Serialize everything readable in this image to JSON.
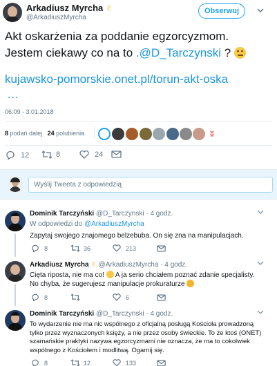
{
  "main_tweet": {
    "author_name": "Arkadiusz Myrcha",
    "author_handle": "@ArkadiuszMyrcha",
    "follow_label": "Obserwuj",
    "text_line1": "Akt oskarżenia za poddanie egzorcyzmom.",
    "text_line2_prefix": "Jestem ciekawy co na to ",
    "text_mention": ".@D_Tarczynski",
    "text_line2_suffix": " ?",
    "link": "kujawsko-pomorskie.onet.pl/torun-akt-oska",
    "link_ellipsis": "…",
    "timestamp": "06:09 - 3.01.2018",
    "retweets_count": "8",
    "retweets_label": "podań dalej",
    "likes_count": "24",
    "likes_label": "polubienia",
    "actions": {
      "reply": "12",
      "retweet": "8",
      "like": "24"
    }
  },
  "reply_box": {
    "placeholder": "Wyślij Tweeta z odpowiedzią"
  },
  "replies": [
    {
      "name": "Dominik Tarczyński",
      "handle": "@D_Tarczynski",
      "time": "· 4 godz.",
      "in_reply_prefix": "W odpowiedzi do ",
      "in_reply_to": "@ArkadiuszMyrcha",
      "text": "Zapytaj swojego znajomego belzebuba. On się zna na manipulacjach.",
      "reply": "8",
      "retweet": "36",
      "like": "213"
    },
    {
      "name": "Arkadiusz Myrcha",
      "handle": "@ArkadiuszMyrcha",
      "time": "· 4 godz.",
      "text_a": "Cięta riposta, nie ma co! ",
      "text_b": " A ja serio chciałem poznać zdanie specjalisty. No chyba, że sugerujesz manipulacje prokuraturze ",
      "reply": "8",
      "retweet": "",
      "like": "6"
    },
    {
      "name": "Dominik Tarczyński",
      "handle": "@D_Tarczynski",
      "time": "· 4 godz.",
      "text": "To wydarzenie nie ma nic wspólnego z oficjalną posługą Kościoła prowadzoną tylko przez wyznaczonych księży, a nie przez osoby świeckie. To że ktoś (ONET) szamańskie praktyki nazywa egzorcyzmami nie oznacza, że ma to cokolwiek wspólnego z Kościołem i modlitwą. Ogarnij się.",
      "reply": "8",
      "retweet": "12",
      "like": "133"
    }
  ],
  "colors": {
    "accent": "#1da1f2",
    "text": "#14171a",
    "muted": "#657786",
    "divider": "#e6ecf0"
  }
}
